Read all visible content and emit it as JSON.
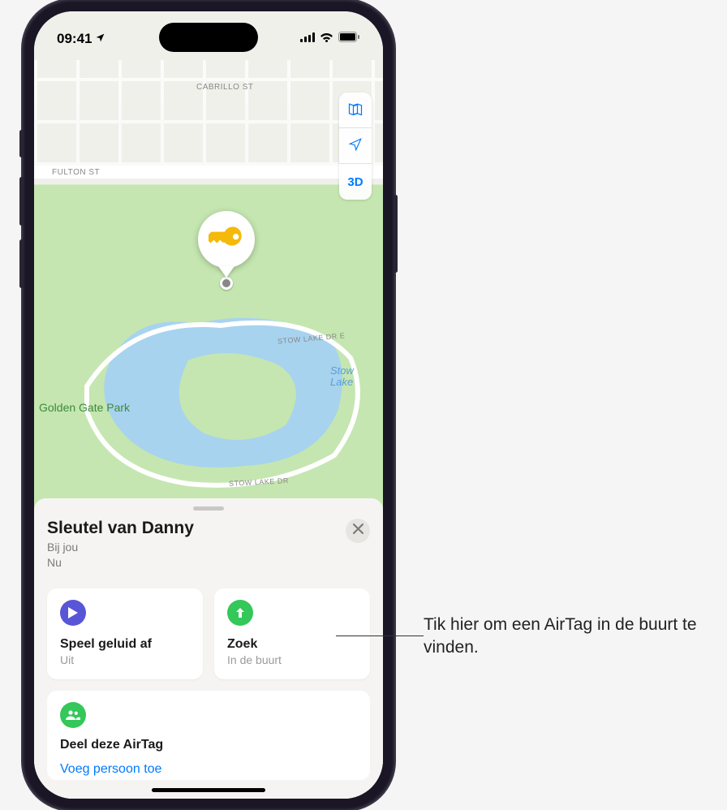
{
  "status_bar": {
    "time": "09:41"
  },
  "map": {
    "streets": {
      "fulton": "FULTON ST",
      "cabrillo": "CABRILLO ST",
      "stow_lake_dr_e": "STOW LAKE DR E",
      "stow_lake_dr": "STOW LAKE DR"
    },
    "park_label": "Golden Gate Park",
    "lake_label_1": "Stow",
    "lake_label_2": "Lake",
    "controls": {
      "mode_3d": "3D"
    }
  },
  "sheet": {
    "title": "Sleutel van Danny",
    "location_line": "Bij jou",
    "time_line": "Nu",
    "cards": {
      "play_sound": {
        "title": "Speel geluid af",
        "subtitle": "Uit"
      },
      "find": {
        "title": "Zoek",
        "subtitle": "In de buurt"
      }
    },
    "share": {
      "title": "Deel deze AirTag",
      "add_person": "Voeg persoon toe"
    }
  },
  "callout": {
    "text": "Tik hier om een AirTag in de buurt te vinden."
  }
}
